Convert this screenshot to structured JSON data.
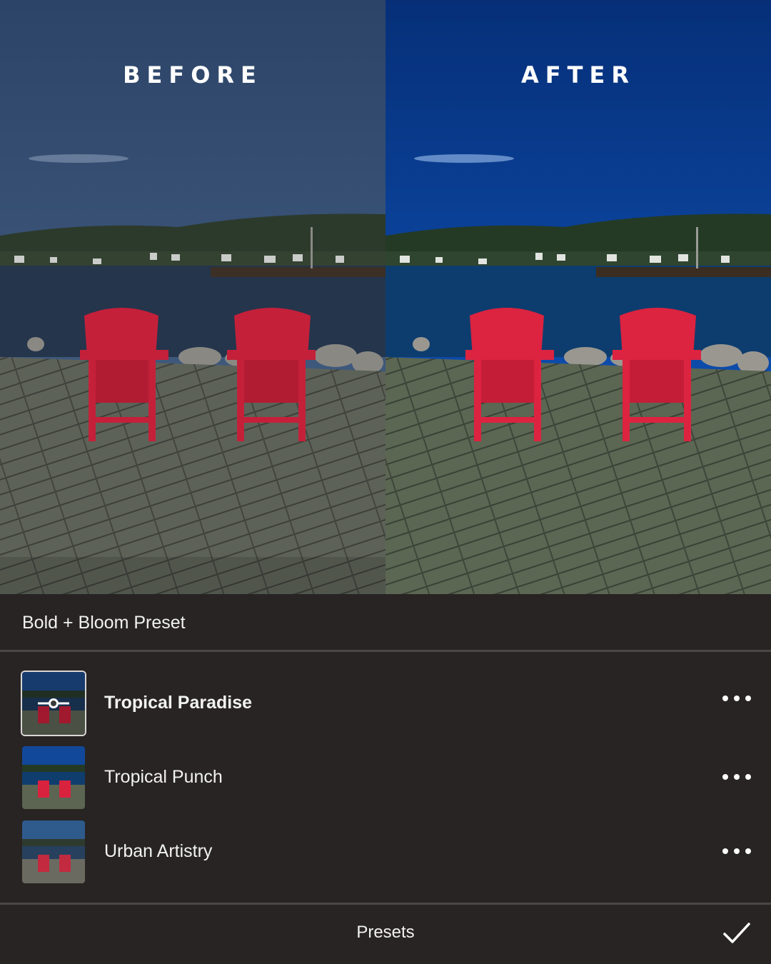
{
  "comparison": {
    "before_label": "BEFORE",
    "after_label": "AFTER"
  },
  "panel": {
    "preset_group_title": "Bold + Bloom Preset",
    "presets": [
      {
        "label": "Tropical Paradise",
        "selected": true,
        "icon": "adjust-slider-icon"
      },
      {
        "label": "Tropical Punch",
        "selected": false
      },
      {
        "label": "Urban Artistry",
        "selected": false
      }
    ],
    "more_icon": "more-horizontal-icon"
  },
  "bottom_bar": {
    "title": "Presets",
    "confirm_icon": "checkmark-icon"
  },
  "colors": {
    "panel_background": "#272423",
    "before_sky": "#2f4a6b",
    "after_sky": "#0a3c8e",
    "chair_red": "#d4223a"
  }
}
